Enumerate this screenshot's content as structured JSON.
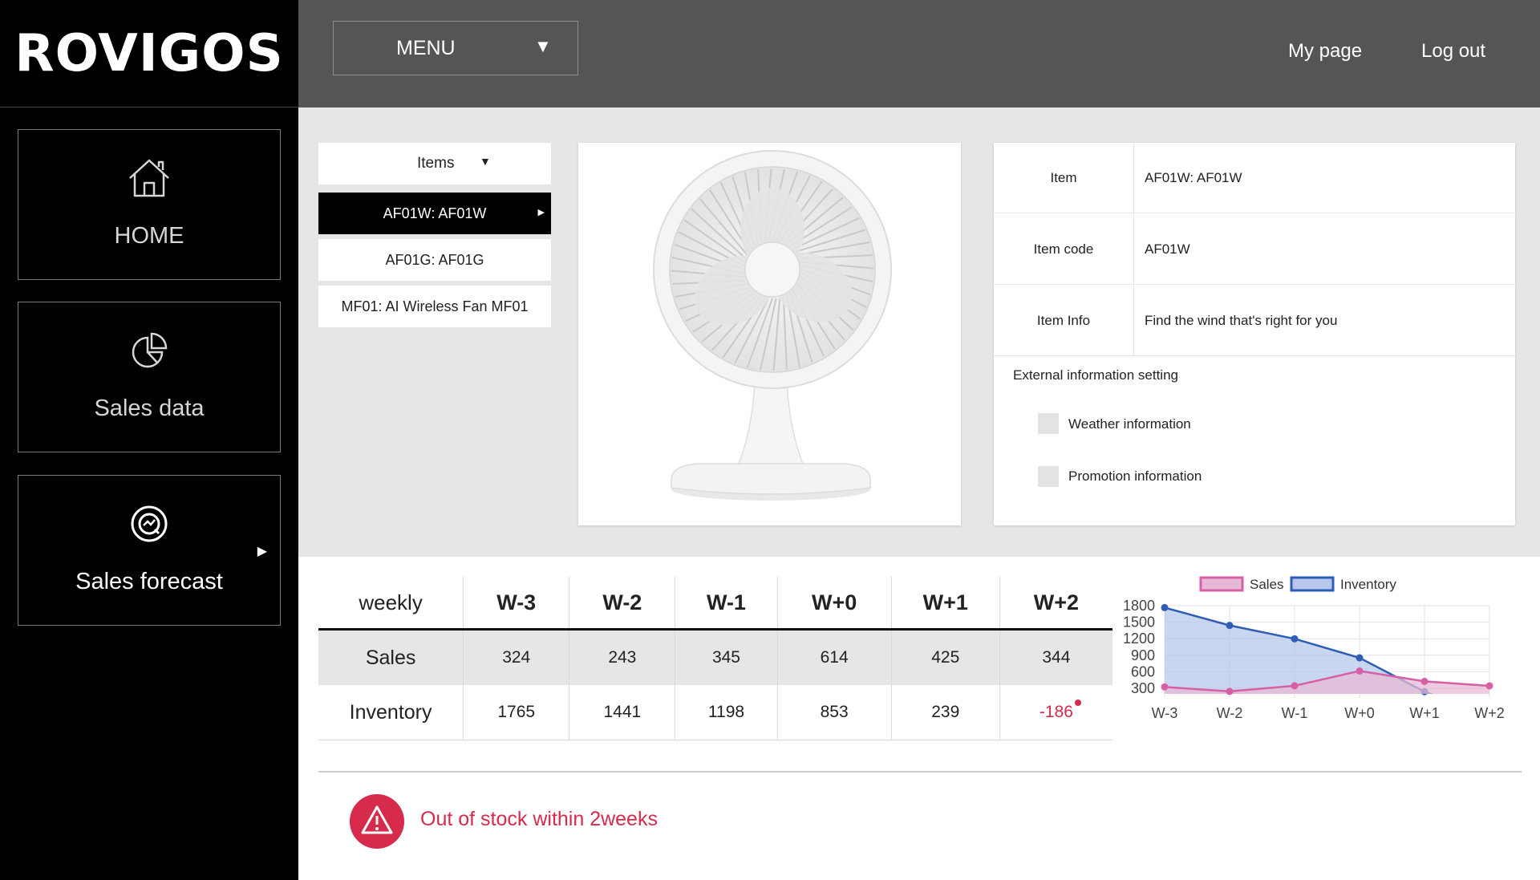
{
  "brand": "ROVIGOS",
  "sidebar": {
    "items": [
      {
        "label": "HOME",
        "icon": "home-icon"
      },
      {
        "label": "Sales data",
        "icon": "pie-chart-icon"
      },
      {
        "label": "Sales forecast",
        "icon": "forecast-icon",
        "active": true
      }
    ]
  },
  "topbar": {
    "menu_label": "MENU",
    "my_page": "My page",
    "logout": "Log out"
  },
  "items": {
    "header": "Items",
    "list": [
      "AF01W: AF01W",
      "AF01G: AF01G",
      "MF01: AI Wireless Fan MF01"
    ],
    "selected_index": 0
  },
  "product": {
    "image": "desk-fan-image",
    "rows": [
      {
        "key": "Item",
        "value": "AF01W: AF01W"
      },
      {
        "key": "Item code",
        "value": "AF01W"
      },
      {
        "key": "Item Info",
        "value": "Find the wind that's right for you"
      }
    ],
    "external_title": "External information setting",
    "options": [
      {
        "label": "Weather information",
        "checked": false
      },
      {
        "label": "Promotion information",
        "checked": false
      }
    ]
  },
  "forecast_table": {
    "corner": "weekly",
    "weeks": [
      "W-3",
      "W-2",
      "W-1",
      "W+0",
      "W+1",
      "W+2"
    ],
    "rows": [
      {
        "label": "Sales",
        "values": [
          "324",
          "243",
          "345",
          "614",
          "425",
          "344"
        ]
      },
      {
        "label": "Inventory",
        "values": [
          "1765",
          "1441",
          "1198",
          "853",
          "239",
          "-186"
        ]
      }
    ]
  },
  "chart_data": {
    "type": "area",
    "x": [
      "W-3",
      "W-2",
      "W-1",
      "W+0",
      "W+1",
      "W+2"
    ],
    "yticks": [
      1800,
      1500,
      1200,
      900,
      600,
      300
    ],
    "ylim": [
      0,
      1800
    ],
    "legend_position": "top",
    "series": [
      {
        "name": "Sales",
        "values": [
          324,
          243,
          345,
          614,
          425,
          344
        ],
        "color": "#d65fa6",
        "fill": "#e7b9d6"
      },
      {
        "name": "Inventory",
        "values": [
          1765,
          1441,
          1198,
          853,
          239,
          -186
        ],
        "color": "#2f5cb5",
        "fill": "#b7c8ea"
      }
    ]
  },
  "alert": {
    "text": "Out of stock within 2weeks",
    "color": "#d62b4b",
    "icon": "warning-icon"
  },
  "colors": {
    "sidebar_bg": "#000000",
    "topbar_bg": "#555555",
    "content_bg": "#e6e6e6",
    "alert": "#d62b4b"
  }
}
